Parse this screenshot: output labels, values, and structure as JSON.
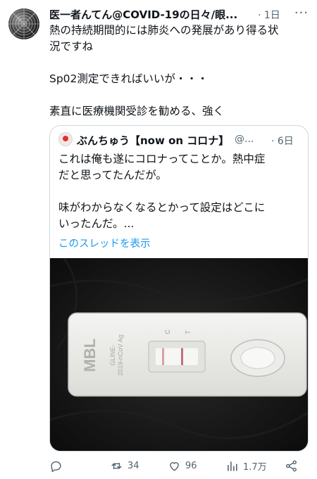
{
  "tweet": {
    "display_name": "医一者んてん@COVID-19の日々/眼...",
    "time": "· 1日",
    "more_label": "···",
    "text_lines": [
      "熱の持続期間的には肺炎への発展があり得る状",
      "況ですね",
      "Sp02測定できればいいが・・・",
      "素直に医療機関受診を勧める、強く"
    ],
    "avatar_icon": "spiderweb-avatar"
  },
  "quote": {
    "display_name": "ぶんちゅう【now on コロナ】",
    "handle": "@...",
    "time": "· 6日",
    "text_lines": [
      "これは俺も遂にコロナってことか。熱中症",
      "だと思ってたんだが。",
      "味がわからなくなるとかって設定はどこに",
      "いったんだ。..."
    ],
    "show_thread": "このスレッドを表示",
    "link_color": "#1d9bf0",
    "image": {
      "brand": "MBL",
      "product_line1": "GLINE-",
      "product_line2": "2019-nCoV Ag",
      "mark_c": "C",
      "mark_t": "T"
    }
  },
  "actions": {
    "reply_count": "",
    "retweet_count": "34",
    "like_count": "96",
    "views_count": "1.7万"
  }
}
